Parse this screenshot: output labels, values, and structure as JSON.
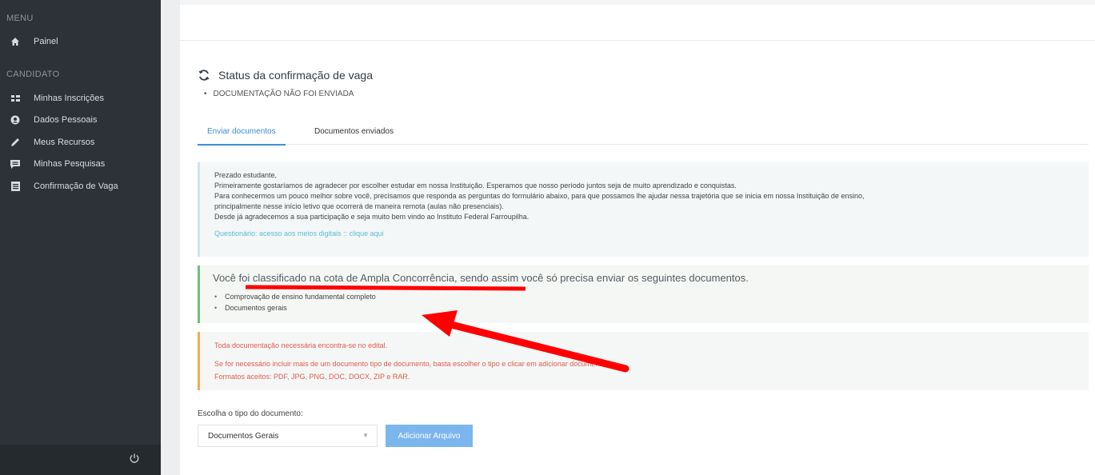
{
  "sidebar": {
    "menu_title": "MENU",
    "menu_items": [
      {
        "label": "Painel",
        "icon": "home-icon"
      }
    ],
    "candidate_title": "CANDIDATO",
    "candidate_items": [
      {
        "label": "Minhas Inscrições",
        "icon": "grid-icon"
      },
      {
        "label": "Dados Pessoais",
        "icon": "user-circle-icon"
      },
      {
        "label": "Meus Recursos",
        "icon": "pencil-icon"
      },
      {
        "label": "Minhas Pesquisas",
        "icon": "comment-icon"
      },
      {
        "label": "Confirmação de Vaga",
        "icon": "document-icon"
      }
    ],
    "logout_icon": "power-icon"
  },
  "status": {
    "title": "Status da confirmação de vaga",
    "icon": "refresh-icon",
    "item": "DOCUMENTAÇÃO NÃO FOI ENVIADA"
  },
  "tabs": [
    {
      "label": "Enviar documentos",
      "active": true
    },
    {
      "label": "Documentos enviados",
      "active": false
    }
  ],
  "info_panel": {
    "lines": [
      "Prezado estudante,",
      "Primeiramente gostaríamos de agradecer por escolher estudar em nossa Instituição. Esperamos que nosso período juntos seja de muito aprendizado e conquistas.",
      "Para conhecermos um pouco melhor sobre você, precisamos que responda as perguntas do formulário abaixo, para que possamos lhe ajudar nessa trajetória que se inicia em nossa Instituição de ensino,",
      "principalmente nesse início letivo que ocorrerá de maneira remota (aulas não presenciais).",
      "Desde já agradecemos a sua participação e seja muito bem vindo ao Instituto Federal Farroupilha."
    ],
    "link": "Questionário: acesso aos meios digitais :: clique aqui"
  },
  "success_panel": {
    "headline": "Você foi classificado na cota de Ampla Concorrência, sendo assim você só precisa enviar os seguintes documentos.",
    "documents": [
      "Comprovação de ensino fundamental completo",
      "Documentos gerais"
    ]
  },
  "warning_panel": {
    "line1": "Toda documentação necessária encontra-se no edital.",
    "line2": "Se for necessário incluir mais de um documento tipo de documento, basta escolher o tipo e clicar em adicionar documento",
    "line3": "Formatos aceitos: PDF, JPG, PNG, DOC, DOCX, ZIP e RAR."
  },
  "upload": {
    "label": "Escolha o tipo do documento:",
    "selected": "Documentos Gerais",
    "button": "Adicionar Arquivo"
  },
  "colors": {
    "sidebar_bg": "#2d3238",
    "accent_blue": "#3a8fd6",
    "success_border": "#6fbf7f",
    "warning_border": "#f0ad4e",
    "warning_text": "#e25b4b",
    "annotation_red": "#ff0000"
  }
}
